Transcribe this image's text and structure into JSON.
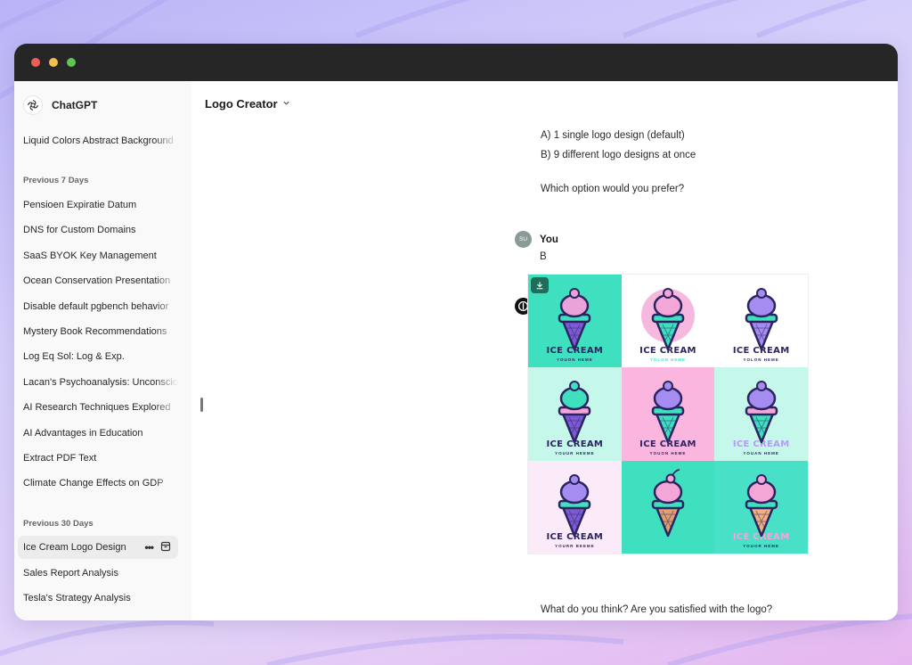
{
  "window": {
    "traffic_lights": [
      {
        "name": "close",
        "color": "#ec5f57"
      },
      {
        "name": "minimize",
        "color": "#f5bd4f"
      },
      {
        "name": "maximize",
        "color": "#5fc553"
      }
    ]
  },
  "sidebar": {
    "brand": "ChatGPT",
    "top_items": [
      {
        "label": "Liquid Colors Abstract Background"
      }
    ],
    "sections": [
      {
        "heading": "Previous 7 Days",
        "items": [
          {
            "label": "Pensioen Expiratie Datum"
          },
          {
            "label": "DNS for Custom Domains"
          },
          {
            "label": "SaaS BYOK Key Management"
          },
          {
            "label": "Ocean Conservation Presentation"
          },
          {
            "label": "Disable default pgbench behavior"
          },
          {
            "label": "Mystery Book Recommendations"
          },
          {
            "label": "Log Eq Sol: Log & Exp."
          },
          {
            "label": "Lacan's Psychoanalysis: Unconscious"
          },
          {
            "label": "AI Research Techniques Explored"
          },
          {
            "label": "AI Advantages in Education"
          },
          {
            "label": "Extract PDF Text"
          },
          {
            "label": "Climate Change Effects on GDP"
          }
        ]
      },
      {
        "heading": "Previous 30 Days",
        "items": [
          {
            "label": "Ice Cream Logo Design",
            "active": true
          },
          {
            "label": "Sales Report Analysis"
          },
          {
            "label": "Tesla's Strategy Analysis"
          }
        ]
      }
    ]
  },
  "header": {
    "title": "Logo Creator"
  },
  "chat": {
    "prev_message_lines": [
      "A) 1 single logo design (default)",
      "B) 9 different logo designs at once",
      "",
      "Which option would you prefer?"
    ],
    "user": {
      "initials": "SU",
      "name": "You",
      "message": "B"
    },
    "bot": {
      "name": "Logo Creator",
      "followup": "What do you think? Are you satisfied with the logo?"
    },
    "logo_grid": [
      {
        "bg": "#3fe0c0",
        "title": "ICE CREAM",
        "sub": "YOUON HEME",
        "title_color": "#2c2460",
        "sub_color": "#2c2460",
        "scoop": "#e9a3d9",
        "scoop2": "#3fe0c0",
        "cone": "#7d5bd6"
      },
      {
        "bg": "#ffffff",
        "title": "ICE CREAM",
        "sub": "YOLON HEME",
        "title_color": "#2c2460",
        "sub_color": "#3fe0c0",
        "scoop": "#f4a6d7",
        "scoop2": "#3fe0c0",
        "cone": "#3fe0c0",
        "circle": "#f7b8df"
      },
      {
        "bg": "#ffffff",
        "title": "ICE CREAM",
        "sub": "YOLON HEME",
        "title_color": "#2c2460",
        "sub_color": "#2c2460",
        "scoop": "#a48cf0",
        "scoop2": "#3fe0c0",
        "cone": "#a48cf0"
      },
      {
        "bg": "#c5f7ea",
        "title": "ICE CREAM",
        "sub": "YOUUR HEEME",
        "title_color": "#2c2460",
        "sub_color": "#2c2460",
        "scoop": "#3fe0c0",
        "scoop2": "#f4a6d7",
        "cone": "#7d5bd6"
      },
      {
        "bg": "#fbb6df",
        "title": "ICE CREAM",
        "sub": "YOUON HEME",
        "title_color": "#2c2460",
        "sub_color": "#2c2460",
        "scoop": "#a48cf0",
        "scoop2": "#3fe0c0",
        "cone": "#3fe0c0"
      },
      {
        "bg": "#c5f7ea",
        "title": "ICE CREAM",
        "sub": "YOUAN HEME",
        "title_color": "#b69bf5",
        "sub_color": "#2c2460",
        "scoop": "#a48cf0",
        "scoop2": "#f4a6d7",
        "cone": "#3fe0c0"
      },
      {
        "bg": "#fbeaf7",
        "title": "ICE CREAM",
        "sub": "YOURR BEEME",
        "title_color": "#2c2460",
        "sub_color": "#2c2460",
        "scoop": "#a48cf0",
        "scoop2": "#3fe0c0",
        "cone": "#7d5bd6"
      },
      {
        "bg": "#3fe0c0",
        "title": "",
        "sub": "",
        "title_color": "#2c2460",
        "sub_color": "#2c2460",
        "scoop": "#f4a6d7",
        "scoop2": "#3fe0c0",
        "cone": "#e0a070",
        "cherry": true
      },
      {
        "bg": "#48e0c6",
        "title": "ICE CREAM",
        "sub": "YOUOR HEME",
        "title_color": "#f4a6d7",
        "sub_color": "#2c2460",
        "scoop": "#f4a6d7",
        "scoop2": "#3fe0c0",
        "cone": "#f0b080"
      }
    ]
  }
}
